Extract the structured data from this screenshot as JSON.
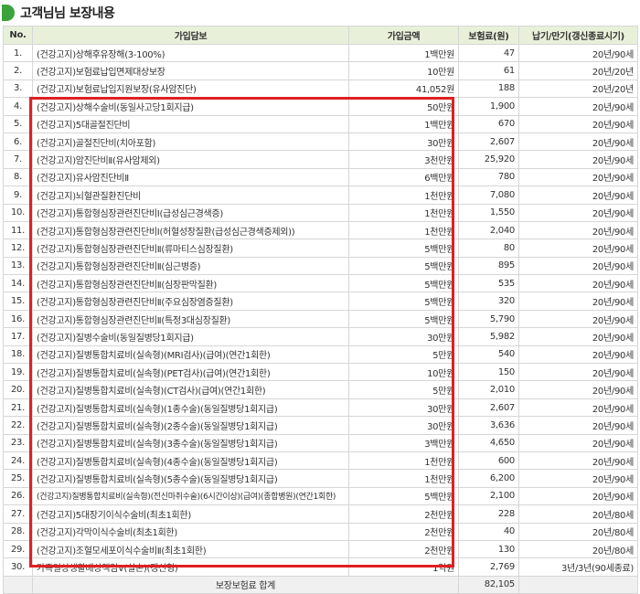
{
  "title": "고객님님 보장내용",
  "headers": [
    "No.",
    "가입담보",
    "가입금액",
    "보험료(원)",
    "납기/만기(갱신종료시기)"
  ],
  "rows": [
    [
      "1.",
      "(건강고지)상해후유장해(3-100%)",
      "1백만원",
      "47",
      "20년/90세"
    ],
    [
      "2.",
      "(건강고지)보험료납입면제대상보장",
      "10만원",
      "61",
      "20년/20년"
    ],
    [
      "3.",
      "(건강고지)보험료납입지원보장(유사암진단)",
      "41,052원",
      "188",
      "20년/20년"
    ],
    [
      "4.",
      "(건강고지)상해수술비(동일사고당1회지급)",
      "50만원",
      "1,900",
      "20년/90세"
    ],
    [
      "5.",
      "(건강고지)5대골절진단비",
      "1백만원",
      "670",
      "20년/90세"
    ],
    [
      "6.",
      "(건강고지)골절진단비(치아포함)",
      "30만원",
      "2,607",
      "20년/90세"
    ],
    [
      "7.",
      "(건강고지)암진단비Ⅱ(유사암제외)",
      "3천만원",
      "25,920",
      "20년/90세"
    ],
    [
      "8.",
      "(건강고지)유사암진단비Ⅱ",
      "6백만원",
      "780",
      "20년/90세"
    ],
    [
      "9.",
      "(건강고지)뇌혈관질환진단비",
      "1천만원",
      "7,080",
      "20년/90세"
    ],
    [
      "10.",
      "(건강고지)통합형심장관련진단비Ⅰ(급성심근경색증)",
      "1천만원",
      "1,550",
      "20년/90세"
    ],
    [
      "11.",
      "(건강고지)통합형심장관련진단비Ⅰ(허혈성장질환(급성심근경색증제외))",
      "1천만원",
      "2,040",
      "20년/90세"
    ],
    [
      "12.",
      "(건강고지)통합형심장관련진단비Ⅱ(류마티스심장질환)",
      "5백만원",
      "80",
      "20년/90세"
    ],
    [
      "13.",
      "(건강고지)통합형심장관련진단비Ⅱ(심근병증)",
      "5백만원",
      "895",
      "20년/90세"
    ],
    [
      "14.",
      "(건강고지)통합형심장관련진단비Ⅱ(심장판막질환)",
      "5백만원",
      "535",
      "20년/90세"
    ],
    [
      "15.",
      "(건강고지)통합형심장관련진단비Ⅱ(주요심장염증질환)",
      "5백만원",
      "320",
      "20년/90세"
    ],
    [
      "16.",
      "(건강고지)통합형심장관련진단비Ⅱ(특정3대심장질환)",
      "5백만원",
      "5,790",
      "20년/90세"
    ],
    [
      "17.",
      "(건강고지)질병수술비(동일질병당1회지급)",
      "30만원",
      "5,982",
      "20년/90세"
    ],
    [
      "18.",
      "(건강고지)질병통합치료비(실속형)(MRI검사)(급여)(연간1회한)",
      "5만원",
      "540",
      "20년/90세"
    ],
    [
      "19.",
      "(건강고지)질병통합치료비(실속형)(PET검사)(급여)(연간1회한)",
      "10만원",
      "150",
      "20년/90세"
    ],
    [
      "20.",
      "(건강고지)질병통합치료비(실속형)(CT검사)(급여)(연간1회한)",
      "5만원",
      "2,010",
      "20년/90세"
    ],
    [
      "21.",
      "(건강고지)질병통합치료비(실속형)(1종수술)(동일질병당1회지급)",
      "30만원",
      "2,607",
      "20년/90세"
    ],
    [
      "22.",
      "(건강고지)질병통합치료비(실속형)(2종수술)(동일질병당1회지급)",
      "30만원",
      "3,636",
      "20년/90세"
    ],
    [
      "23.",
      "(건강고지)질병통합치료비(실속형)(3종수술)(동일질병당1회지급)",
      "3백만원",
      "4,650",
      "20년/90세"
    ],
    [
      "24.",
      "(건강고지)질병통합치료비(실속형)(4종수술)(동일질병당1회지급)",
      "1천만원",
      "600",
      "20년/90세"
    ],
    [
      "25.",
      "(건강고지)질병통합치료비(실속형)(5종수술)(동일질병당1회지급)",
      "1천만원",
      "6,200",
      "20년/90세"
    ],
    [
      "26.",
      "(건강고지)질병통합치료비(실속형)(전신마취수술)(6시간이상)(급여)(종합병원)(연간1회한)",
      "5백만원",
      "2,100",
      "20년/90세"
    ],
    [
      "27.",
      "(건강고지)5대장기이식수술비(최초1회한)",
      "2천만원",
      "228",
      "20년/80세"
    ],
    [
      "28.",
      "(건강고지)각막이식수술비(최초1회한)",
      "2천만원",
      "40",
      "20년/80세"
    ],
    [
      "29.",
      "(건강고지)조혈모세포이식수술비Ⅱ(최초1회한)",
      "2천만원",
      "130",
      "20년/80세"
    ],
    [
      "30.",
      "가족일상생활배상책임Ⅴ(실손)(갱신형)",
      "1억원",
      "2,769",
      "3년/3년(90세종료)"
    ]
  ],
  "total": {
    "label": "보장보험료 합계",
    "value": "82,105"
  }
}
